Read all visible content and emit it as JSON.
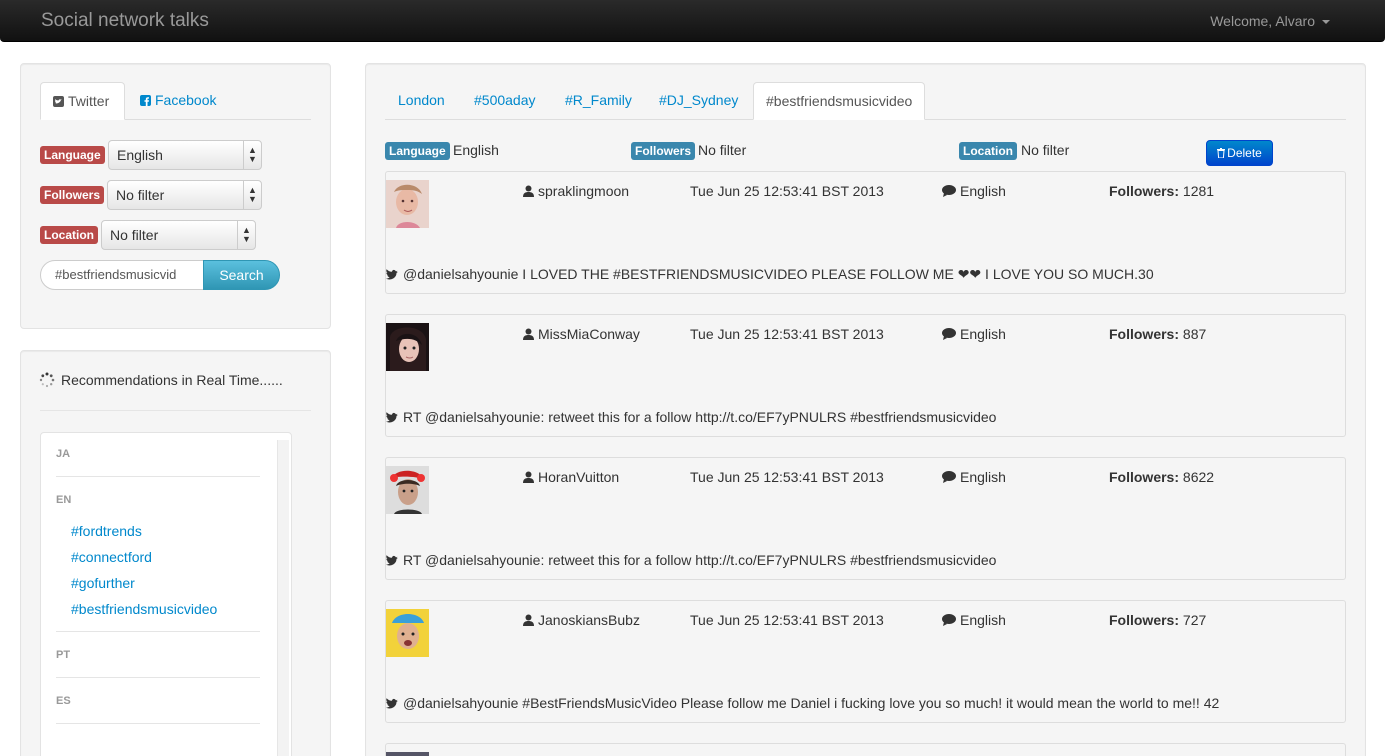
{
  "navbar": {
    "brand": "Social network talks",
    "welcome": "Welcome, Alvaro"
  },
  "sidebar": {
    "tabs": [
      {
        "label": "Twitter",
        "icon": "twitter-square-icon"
      },
      {
        "label": "Facebook",
        "icon": "facebook-square-icon"
      }
    ],
    "filters": [
      {
        "label": "Language",
        "value": "English"
      },
      {
        "label": "Followers",
        "value": "No filter"
      },
      {
        "label": "Location",
        "value": "No filter"
      }
    ],
    "search": {
      "value": "#bestfriendsmusicvid",
      "button": "Search"
    },
    "recommendations": {
      "title": "Recommendations in Real Time......",
      "groups": [
        {
          "header": "JA",
          "items": []
        },
        {
          "header": "EN",
          "items": [
            "#fordtrends",
            "#connectford",
            "#gofurther",
            "#bestfriendsmusicvideo"
          ]
        },
        {
          "header": "PT",
          "items": []
        },
        {
          "header": "ES",
          "items": []
        }
      ]
    }
  },
  "main": {
    "tabs": [
      "London",
      "#500aday",
      "#R_Family",
      "#DJ_Sydney",
      "#bestfriendsmusicvideo"
    ],
    "active_tab": "#bestfriendsmusicvideo",
    "filter_bar": {
      "language_label": "Language",
      "language_value": "English",
      "followers_label": "Followers",
      "followers_value": "No filter",
      "location_label": "Location",
      "location_value": "No filter",
      "delete": "Delete"
    },
    "tweets": [
      {
        "user": "spraklingmoon",
        "date": "Tue Jun 25 12:53:41 BST 2013",
        "language": "English",
        "followers_label": "Followers:",
        "followers": "1281",
        "text": "@danielsahyounie I LOVED THE #BESTFRIENDSMUSICVIDEO PLEASE FOLLOW ME ❤❤ I LOVE YOU SO MUCH.30"
      },
      {
        "user": "MissMiaConway",
        "date": "Tue Jun 25 12:53:41 BST 2013",
        "language": "English",
        "followers_label": "Followers:",
        "followers": "887",
        "text": "RT @danielsahyounie: retweet this for a follow http://t.co/EF7yPNULRS #bestfriendsmusicvideo"
      },
      {
        "user": "HoranVuitton",
        "date": "Tue Jun 25 12:53:41 BST 2013",
        "language": "English",
        "followers_label": "Followers:",
        "followers": "8622",
        "text": "RT @danielsahyounie: retweet this for a follow http://t.co/EF7yPNULRS #bestfriendsmusicvideo"
      },
      {
        "user": "JanoskiansBubz",
        "date": "Tue Jun 25 12:53:41 BST 2013",
        "language": "English",
        "followers_label": "Followers:",
        "followers": "727",
        "text": "@danielsahyounie #BestFriendsMusicVideo Please follow me Daniel i fucking love you so much! it would mean the world to me!! 42"
      }
    ]
  },
  "colors": {
    "link": "#0088cc",
    "important_label": "#b94a48",
    "info_label": "#3a87ad",
    "primary_button": "#0044cc"
  }
}
